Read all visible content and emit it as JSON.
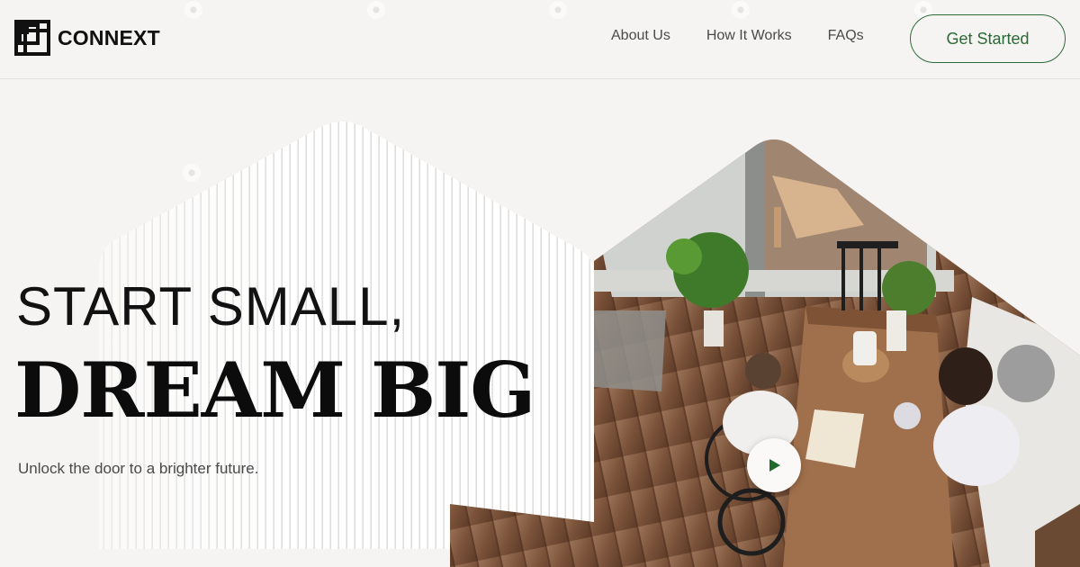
{
  "brand": {
    "name": "CONNEXT"
  },
  "nav": {
    "items": [
      {
        "label": "About Us"
      },
      {
        "label": "How It Works"
      },
      {
        "label": "FAQs"
      }
    ],
    "cta_label": "Get Started"
  },
  "hero": {
    "line1": "START SMALL,",
    "line2": "DREAM BIG",
    "tagline": "Unlock the door to a brighter future."
  },
  "media": {
    "play_icon": "play-icon"
  },
  "colors": {
    "background": "#f6f4f2",
    "accent_green": "#2a6a36",
    "text_dark": "#121212"
  }
}
